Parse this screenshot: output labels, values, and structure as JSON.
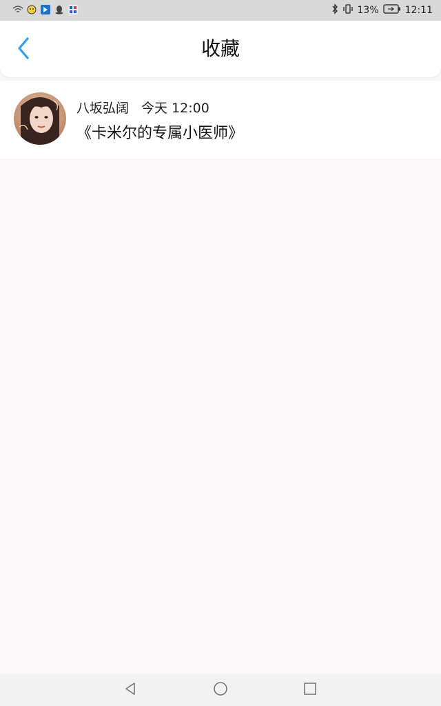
{
  "status_bar": {
    "battery_percent": "13%",
    "time": "12:11",
    "icons": [
      "wifi-icon",
      "app-icon-yellow",
      "app-icon-blue",
      "qq-icon",
      "app-icon-qr",
      "bluetooth-icon",
      "vibrate-icon",
      "battery-icon"
    ]
  },
  "header": {
    "title": "收藏",
    "back_icon": "chevron-left-icon",
    "accent_color": "#2f9ee8"
  },
  "favorites": [
    {
      "author": "八坂弘阔",
      "time": "今天 12:00",
      "title": "《卡米尔的专属小医师》",
      "avatar": "avatar-photo"
    }
  ],
  "nav_bar": {
    "icons": [
      "back-triangle-icon",
      "home-circle-icon",
      "recents-square-icon"
    ]
  }
}
